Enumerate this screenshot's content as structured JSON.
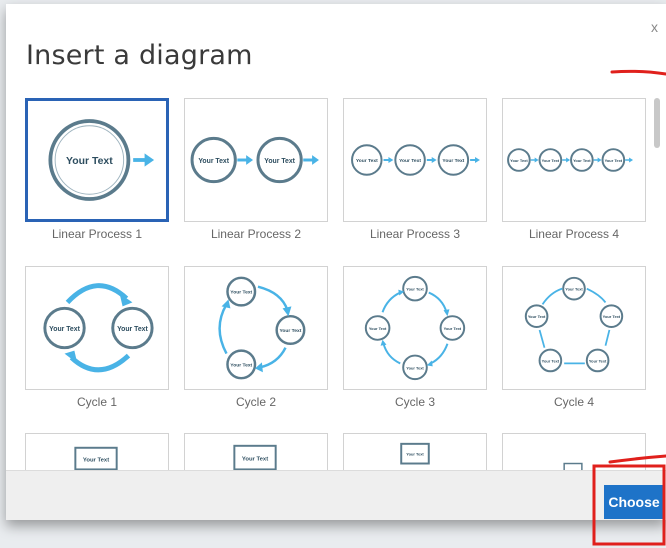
{
  "dialog": {
    "title": "Insert a diagram",
    "close_label": "x"
  },
  "tiles": [
    {
      "label": "Linear Process 1",
      "selected": true
    },
    {
      "label": "Linear Process 2",
      "selected": false
    },
    {
      "label": "Linear Process 3",
      "selected": false
    },
    {
      "label": "Linear Process 4",
      "selected": false
    },
    {
      "label": "Cycle 1",
      "selected": false
    },
    {
      "label": "Cycle 2",
      "selected": false
    },
    {
      "label": "Cycle 3",
      "selected": false
    },
    {
      "label": "Cycle 4",
      "selected": false
    }
  ],
  "placeholder_text": "Your Text",
  "footer": {
    "choose_label": "Choose"
  },
  "colors": {
    "accent": "#1e73c8",
    "selected_border": "#2a63b5",
    "circle_stroke": "#5b7b8c",
    "arrow": "#49b3e6",
    "annotation": "#e0201c"
  }
}
